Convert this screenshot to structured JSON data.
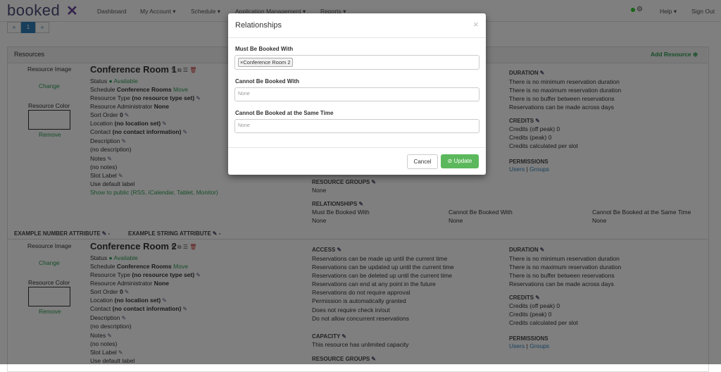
{
  "nav": {
    "logo": "booked",
    "items": [
      "Dashboard",
      "My Account ▾",
      "Schedule ▾",
      "Application Management ▾",
      "Reports ▾"
    ],
    "help": "Help ▾",
    "signout": "Sign Out"
  },
  "pager": {
    "prev": "«",
    "page": "1",
    "next": "»"
  },
  "panel": {
    "title": "Resources",
    "add": "Add Resource ⊕"
  },
  "labels": {
    "image": "Resource Image",
    "change": "Change",
    "color": "Resource Color",
    "remove": "Remove",
    "status": "Status",
    "available": "Available",
    "schedule": "Schedule",
    "schedule_val": "Conference Rooms",
    "move": "Move",
    "type": "Resource Type",
    "type_val": "(no resource type set)",
    "admin": "Resource Administrator",
    "admin_val": "None",
    "sort": "Sort Order",
    "sort_val": "0",
    "location": "Location",
    "location_val": "(no location set)",
    "contact": "Contact",
    "contact_val": "(no contact information)",
    "description": "Description",
    "no_desc": "(no description)",
    "notes": "Notes",
    "no_notes": "(no notes)",
    "slot": "Slot Label",
    "slot_val": "Use default label",
    "public": "Show to public (RSS, iCalendar, Tablet, Monitor)"
  },
  "resources": [
    {
      "name": "Conference Room 1"
    },
    {
      "name": "Conference Room 2"
    }
  ],
  "attributes": {
    "number": "EXAMPLE NUMBER ATTRIBUTE",
    "string": "EXAMPLE STRING ATTRIBUTE",
    "dash": "-"
  },
  "sections": {
    "access": "ACCESS",
    "access_items": [
      "Reservations can be made up until the current time",
      "Reservations can be updated up until the current time",
      "Reservations can be deleted up until the current time",
      "Reservations can end at any point in the future",
      "Reservations do not require approval",
      "Permission is automatically granted",
      "Does not require check in/out",
      "Do not allow concurrent reservations"
    ],
    "capacity": "CAPACITY",
    "capacity_val": "This resource has unlimited capacity",
    "groups": "RESOURCE GROUPS",
    "groups_val": "None",
    "relationships": "RELATIONSHIPS",
    "rel_cols": [
      "Must Be Booked With",
      "Cannot Be Booked With",
      "Cannot Be Booked at the Same Time"
    ],
    "rel_vals": [
      "None",
      "None",
      "None"
    ],
    "duration": "DURATION",
    "duration_items": [
      "There is no minimum reservation duration",
      "There is no maximum reservation duration",
      "There is no buffer between reservations",
      "Reservations can be made across days"
    ],
    "credits": "CREDITS",
    "credits_items": [
      "Credits (off peak) 0",
      "Credits (peak) 0",
      "Credits calculated per slot"
    ],
    "permissions": "PERMISSIONS",
    "users": "Users",
    "sep": "|",
    "groups_link": "Groups"
  },
  "modal": {
    "title": "Relationships",
    "close": "×",
    "must_label": "Must Be Booked With",
    "must_tag": "×Conference Room 2",
    "cannot_label": "Cannot Be Booked With",
    "cannot_ph": "None",
    "same_time_label": "Cannot Be Booked at the Same Time",
    "same_time_ph": "None",
    "cancel": "Cancel",
    "update": "⊘ Update"
  }
}
